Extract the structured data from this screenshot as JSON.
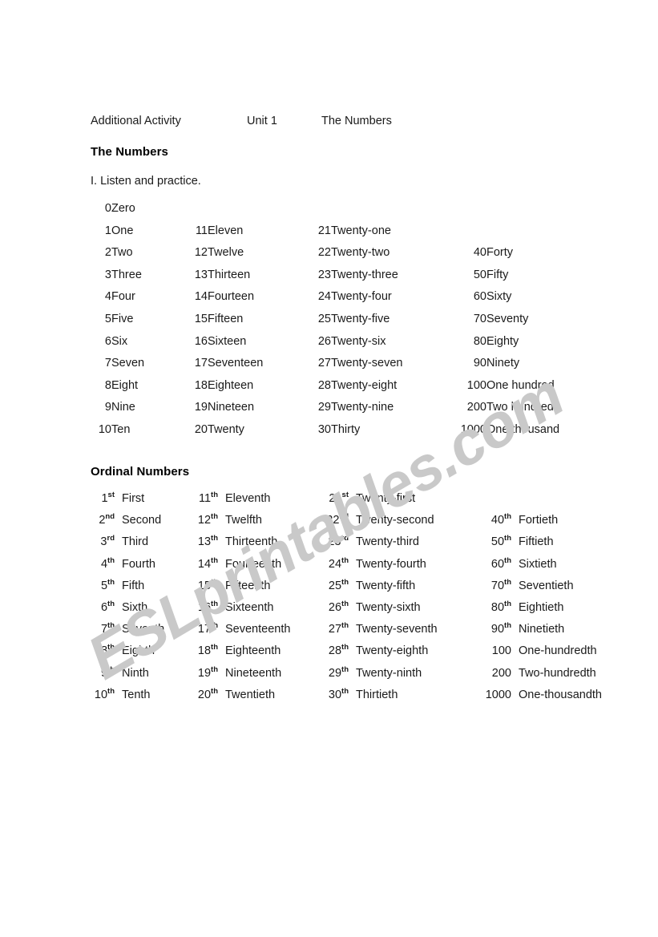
{
  "document": {
    "header": {
      "left": "Additional Activity",
      "middle": "Unit 1",
      "right": "The Numbers"
    },
    "title": "The Numbers",
    "instruction": "I. Listen and practice.",
    "ordinal_title": "Ordinal Numbers"
  },
  "watermark": {
    "text": "ESLprintables.com",
    "color": "#c9c9c9"
  },
  "cardinal_rows": [
    {
      "n1": "0",
      "w1": "Zero",
      "n2": "",
      "w2": "",
      "n3": "",
      "w3": "",
      "n4": "",
      "w4": ""
    },
    {
      "n1": "1",
      "w1": "One",
      "n2": "11",
      "w2": "Eleven",
      "n3": "21",
      "w3": "Twenty-one",
      "n4": "",
      "w4": ""
    },
    {
      "n1": "2",
      "w1": "Two",
      "n2": "12",
      "w2": "Twelve",
      "n3": "22",
      "w3": "Twenty-two",
      "n4": "40",
      "w4": "Forty"
    },
    {
      "n1": "3",
      "w1": "Three",
      "n2": "13",
      "w2": "Thirteen",
      "n3": "23",
      "w3": "Twenty-three",
      "n4": "50",
      "w4": "Fifty"
    },
    {
      "n1": "4",
      "w1": "Four",
      "n2": "14",
      "w2": "Fourteen",
      "n3": "24",
      "w3": "Twenty-four",
      "n4": "60",
      "w4": "Sixty"
    },
    {
      "n1": "5",
      "w1": "Five",
      "n2": "15",
      "w2": "Fifteen",
      "n3": "25",
      "w3": "Twenty-five",
      "n4": "70",
      "w4": "Seventy"
    },
    {
      "n1": "6",
      "w1": "Six",
      "n2": "16",
      "w2": "Sixteen",
      "n3": "26",
      "w3": "Twenty-six",
      "n4": "80",
      "w4": "Eighty"
    },
    {
      "n1": "7",
      "w1": "Seven",
      "n2": "17",
      "w2": "Seventeen",
      "n3": "27",
      "w3": "Twenty-seven",
      "n4": "90",
      "w4": "Ninety"
    },
    {
      "n1": "8",
      "w1": "Eight",
      "n2": "18",
      "w2": "Eighteen",
      "n3": "28",
      "w3": "Twenty-eight",
      "n4": "100",
      "w4": "One hundred"
    },
    {
      "n1": "9",
      "w1": "Nine",
      "n2": "19",
      "w2": "Nineteen",
      "n3": "29",
      "w3": "Twenty-nine",
      "n4": "200",
      "w4": "Two hundred"
    },
    {
      "n1": "10",
      "w1": "Ten",
      "n2": "20",
      "w2": "Twenty",
      "n3": "30",
      "w3": "Thirty",
      "n4": "1000",
      "w4": "One thousand"
    }
  ],
  "ordinal_rows": [
    {
      "n1": "1",
      "s1": "st",
      "w1": "First",
      "n2": "11",
      "s2": "th",
      "w2": "Eleventh",
      "n3": "21",
      "s3": "st",
      "w3": "Twenty-first",
      "n4": "",
      "s4": "",
      "w4": ""
    },
    {
      "n1": "2",
      "s1": "nd",
      "w1": "Second",
      "n2": "12",
      "s2": "th",
      "w2": "Twelfth",
      "n3": "22",
      "s3": "nd",
      "w3": "Twenty-second",
      "n4": "40",
      "s4": "th",
      "w4": "Fortieth"
    },
    {
      "n1": "3",
      "s1": "rd",
      "w1": "Third",
      "n2": "13",
      "s2": "th",
      "w2": "Thirteenth",
      "n3": "23",
      "s3": "rd",
      "w3": "Twenty-third",
      "n4": "50",
      "s4": "th",
      "w4": "Fiftieth"
    },
    {
      "n1": "4",
      "s1": "th",
      "w1": "Fourth",
      "n2": "14",
      "s2": "th",
      "w2": "Fourteenth",
      "n3": "24",
      "s3": "th",
      "w3": "Twenty-fourth",
      "n4": "60",
      "s4": "th",
      "w4": "Sixtieth"
    },
    {
      "n1": "5",
      "s1": "th",
      "w1": "Fifth",
      "n2": "15",
      "s2": "th",
      "w2": "Fifteenth",
      "n3": "25",
      "s3": "th",
      "w3": "Twenty-fifth",
      "n4": "70",
      "s4": "th",
      "w4": "Seventieth"
    },
    {
      "n1": "6",
      "s1": "th",
      "w1": "Sixth",
      "n2": "16",
      "s2": "th",
      "w2": "Sixteenth",
      "n3": "26",
      "s3": "th",
      "w3": "Twenty-sixth",
      "n4": "80",
      "s4": "th",
      "w4": "Eightieth"
    },
    {
      "n1": "7",
      "s1": "th",
      "w1": "Seventh",
      "n2": "17",
      "s2": "th",
      "w2": "Seventeenth",
      "n3": "27",
      "s3": "th",
      "w3": "Twenty-seventh",
      "n4": "90",
      "s4": "th",
      "w4": "Ninetieth"
    },
    {
      "n1": "8",
      "s1": "th",
      "w1": "Eighth",
      "n2": "18",
      "s2": "th",
      "w2": "Eighteenth",
      "n3": "28",
      "s3": "th",
      "w3": "Twenty-eighth",
      "n4": "100",
      "s4": "",
      "w4": "One-hundredth"
    },
    {
      "n1": "9",
      "s1": "th",
      "w1": "Ninth",
      "n2": "19",
      "s2": "th",
      "w2": "Nineteenth",
      "n3": "29",
      "s3": "th",
      "w3": "Twenty-ninth",
      "n4": "200",
      "s4": "",
      "w4": "Two-hundredth"
    },
    {
      "n1": "10",
      "s1": "th",
      "w1": "Tenth",
      "n2": "20",
      "s2": "th",
      "w2": "Twentieth",
      "n3": "30",
      "s3": "th",
      "w3": "Thirtieth",
      "n4": "1000",
      "s4": "",
      "w4": "One-thousandth"
    }
  ]
}
